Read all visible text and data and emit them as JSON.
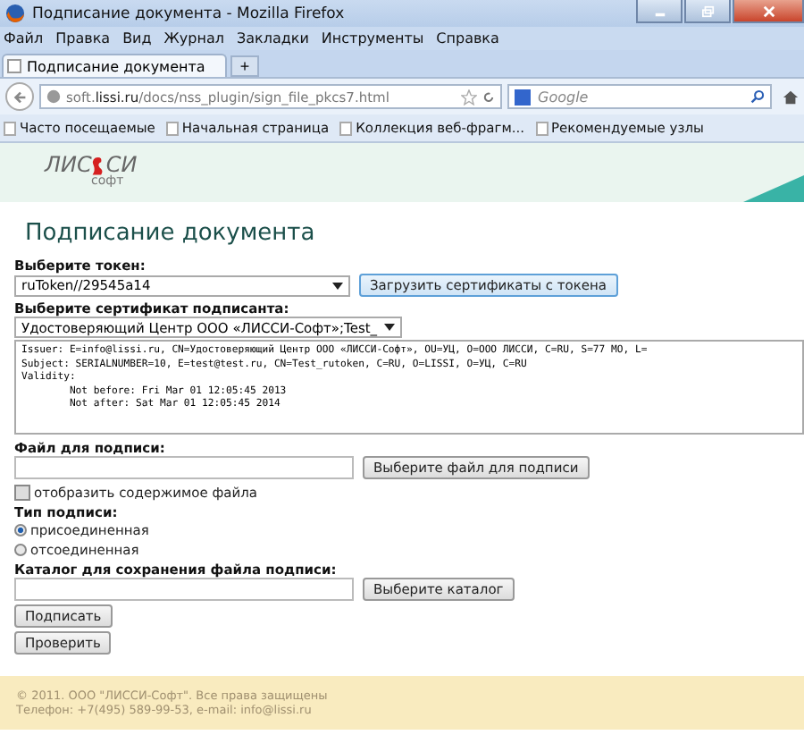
{
  "window": {
    "title": "Подписание документа - Mozilla Firefox"
  },
  "menu": [
    "Файл",
    "Правка",
    "Вид",
    "Журнал",
    "Закладки",
    "Инструменты",
    "Справка"
  ],
  "tabs": [
    {
      "label": "Подписание документа",
      "selected": true
    }
  ],
  "new_tab": "+",
  "address": {
    "url": "soft.**lissi.ru**/docs/nss_plugin/sign_file_pkcs7.html"
  },
  "search": {
    "placeholder": "Google"
  },
  "bookmarks": [
    "Часто посещаемые",
    "Начальная страница",
    "Коллекция веб-фрагм...",
    "Рекомендуемые узлы"
  ],
  "page": {
    "logo": {
      "before": "ЛИС",
      "after": "СИ",
      "sub": "софт"
    },
    "heading": "Подписание документа",
    "token": {
      "label": "Выберите токен:",
      "value": "ruToken//29545a14",
      "button": "Загрузить сертификаты с токена"
    },
    "cert": {
      "label": "Выберите сертификат подписанта:",
      "value": "Удостоверяющий Центр ООО «ЛИССИ-Софт»;Test_",
      "details": [
        "Issuer: E=info@lissi.ru, CN=Удостоверяющий Центр ООО «ЛИССИ-Софт», OU=УЦ, O=ООО ЛИССИ, C=RU, S=77 МО, L=",
        "Subject: SERIALNUMBER=10, E=test@test.ru, CN=Test_rutoken, C=RU, O=LISSI, O=УЦ, C=RU",
        "Validity:",
        "        Not before: Fri Mar 01 12:05:45 2013",
        "        Not after: Sat Mar 01 12:05:45 2014"
      ]
    },
    "file": {
      "label": "Файл для подписи:",
      "button": "Выберите файл для подписи"
    },
    "show_contents": {
      "label": "отобразить содержимое файла",
      "checked": false
    },
    "sign_type": {
      "label": "Тип подписи:",
      "options": [
        {
          "label": "присоединенная",
          "selected": true
        },
        {
          "label": "отсоединенная",
          "selected": false
        }
      ]
    },
    "catalog": {
      "label": "Каталог для сохранения файла подписи:",
      "button": "Выберите каталог"
    },
    "actions": [
      "Подписать",
      "Проверить"
    ],
    "footer": [
      "© 2011. ООО \"ЛИССИ-Софт\". Все права защищены",
      "Телефон: +7(495) 589-99-53, e-mail: info@lissi.ru"
    ]
  }
}
